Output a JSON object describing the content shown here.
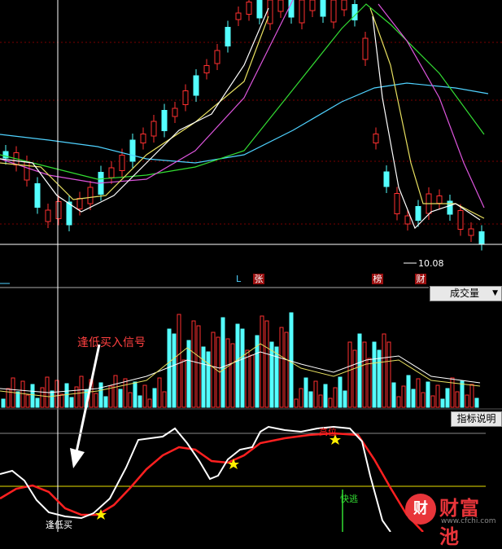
{
  "main_chart": {
    "price_low_label": "10.08",
    "markers": [
      "L",
      "张",
      "榜",
      "财"
    ]
  },
  "volume_chart": {
    "dropdown_label": "成交量"
  },
  "indicator_chart": {
    "explain_button": "指标说明",
    "annotation": "逢低买入信号",
    "signal_buy": "逢低买",
    "signal_sell": "快逃",
    "signal_top": "高位"
  },
  "watermark": {
    "name": "财富池",
    "url": "www.cfchi.com",
    "badge": "财"
  },
  "colors": {
    "up": "#ff3030",
    "down": "#54ffff",
    "background": "#000000",
    "grid": "#8b0000"
  }
}
